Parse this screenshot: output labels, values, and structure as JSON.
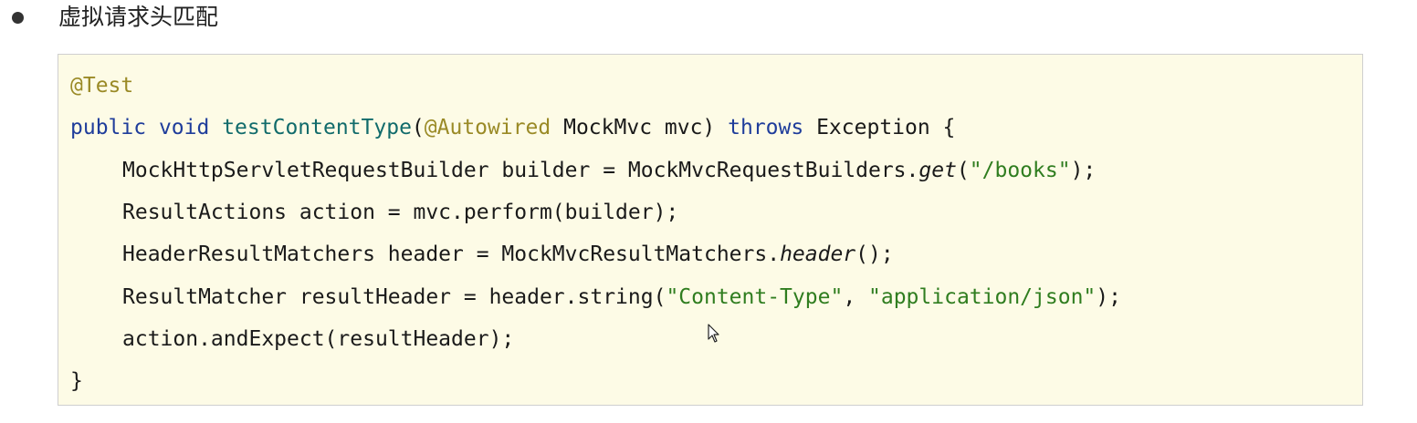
{
  "bullet": {
    "text": "虚拟请求头匹配"
  },
  "code": {
    "line1": {
      "annotation": "@Test"
    },
    "line2": {
      "kw_public": "public",
      "sp1": " ",
      "kw_void": "void",
      "sp2": " ",
      "method": "testContentType",
      "paren_open": "(",
      "annotation": "@Autowired",
      "params": " MockMvc mvc) ",
      "kw_throws": "throws",
      "rest": " Exception {"
    },
    "line3": {
      "pre": "MockHttpServletRequestBuilder builder = MockMvcRequestBuilders.",
      "method": "get",
      "paren_open": "(",
      "string": "\"/books\"",
      "end": ");"
    },
    "line4": {
      "text": "ResultActions action = mvc.perform(builder);"
    },
    "line5": {
      "pre": "HeaderResultMatchers header = MockMvcResultMatchers.",
      "method": "header",
      "end": "();"
    },
    "line6": {
      "pre": "ResultMatcher resultHeader = header.string(",
      "string1": "\"Content-Type\"",
      "sep": ", ",
      "string2": "\"application/json\"",
      "end": ");"
    },
    "line7": {
      "text": "action.andExpect(resultHeader);"
    },
    "line8": {
      "text": "}"
    }
  },
  "colors": {
    "code_background": "#fdfbe6",
    "annotation": "#9a8a26",
    "keyword": "#1f3d9b",
    "method_name": "#116b6b",
    "string": "#2f7d1f"
  },
  "icons": {
    "bullet": "bullet-dot",
    "pointer": "mouse-cursor-icon"
  }
}
